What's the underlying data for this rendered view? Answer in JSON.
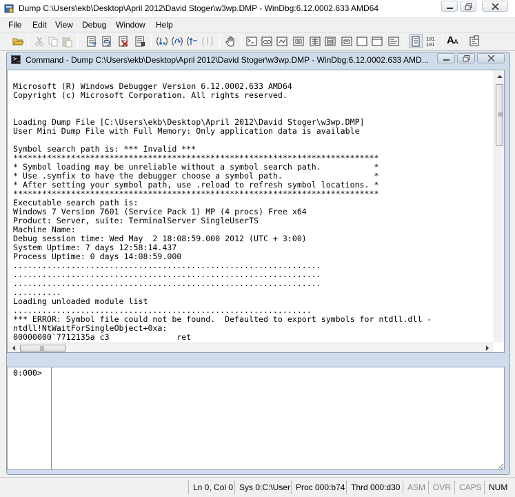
{
  "window": {
    "title": "Dump C:\\Users\\ekb\\Desktop\\April 2012\\David Stoger\\w3wp.DMP - WinDbg:6.12.0002.633 AMD64"
  },
  "menu": [
    "File",
    "Edit",
    "View",
    "Debug",
    "Window",
    "Help"
  ],
  "toolbar": {
    "icons": [
      "open-icon",
      "cut-icon",
      "copy-icon",
      "paste-icon",
      "go-icon",
      "restart-icon",
      "stop-debugging-icon",
      "break-icon",
      "step-into-icon",
      "step-over-icon",
      "step-out-icon",
      "run-to-cursor-icon",
      "hand-icon",
      "command-window-icon",
      "watch-icon",
      "locals-icon",
      "registers-icon",
      "memory-icon",
      "call-stack-icon",
      "disassembly-icon",
      "scratch-pad-icon",
      "source-mode-icon",
      "hex-mode-icon",
      "font-icon",
      "options-icon"
    ],
    "font_label": "A"
  },
  "child": {
    "title": "Command - Dump C:\\Users\\ekb\\Desktop\\April 2012\\David Stoger\\w3wp.DMP - WinDbg:6.12.0002.633 AMD..."
  },
  "output": {
    "lines": [
      "Microsoft (R) Windows Debugger Version 6.12.0002.633 AMD64",
      "Copyright (c) Microsoft Corporation. All rights reserved.",
      "",
      "",
      "Loading Dump File [C:\\Users\\ekb\\Desktop\\April 2012\\David Stoger\\w3wp.DMP]",
      "User Mini Dump File with Full Memory: Only application data is available",
      "",
      "Symbol search path is: *** Invalid ***",
      "****************************************************************************",
      "* Symbol loading may be unreliable without a symbol search path.           *",
      "* Use .symfix to have the debugger choose a symbol path.                   *",
      "* After setting your symbol path, use .reload to refresh symbol locations. *",
      "****************************************************************************",
      "Executable search path is:",
      "Windows 7 Version 7601 (Service Pack 1) MP (4 procs) Free x64",
      "Product: Server, suite: TerminalServer SingleUserTS",
      "Machine Name:",
      "Debug session time: Wed May  2 18:08:59.000 2012 (UTC + 3:00)",
      "System Uptime: 7 days 12:58:14.437",
      "Process Uptime: 0 days 14:08:59.000",
      "................................................................",
      "................................................................",
      "................................................................",
      "..........",
      "Loading unloaded module list",
      "..............................................................",
      "*** ERROR: Symbol file could not be found.  Defaulted to export symbols for ntdll.dll -",
      "ntdll!NtWaitForSingleObject+0xa:",
      "00000000`7712135a c3              ret"
    ]
  },
  "command": {
    "prompt": "0:000>",
    "value": ""
  },
  "status": {
    "position": "Ln 0, Col 0",
    "sys": "Sys 0:C:\\User",
    "proc": "Proc 000:b74",
    "thrd": "Thrd 000:d30",
    "asm": "ASM",
    "ovr": "OVR",
    "caps": "CAPS",
    "num": "NUM"
  }
}
